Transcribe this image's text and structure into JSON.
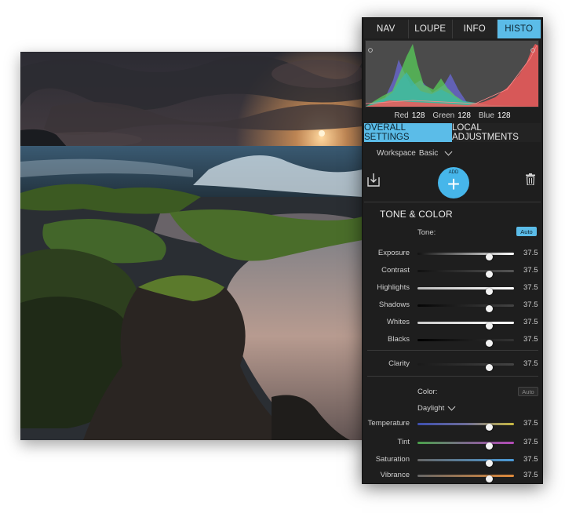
{
  "panel": {
    "tabs": [
      {
        "label": "NAV",
        "active": false
      },
      {
        "label": "LOUPE",
        "active": false
      },
      {
        "label": "INFO",
        "active": false
      },
      {
        "label": "HISTO",
        "active": true
      }
    ],
    "rgb": {
      "red_label": "Red",
      "red_value": "128",
      "green_label": "Green",
      "green_value": "128",
      "blue_label": "Blue",
      "blue_value": "128"
    },
    "settings_tabs": [
      {
        "label": "OVERALL SETTINGS",
        "active": true
      },
      {
        "label": "LOCAL ADJUSTMENTS",
        "active": false
      }
    ],
    "workspace": {
      "label": "Workspace",
      "value": "Basic"
    },
    "add_label": "ADD",
    "section_title": "TONE & COLOR",
    "tone": {
      "label": "Tone:",
      "auto_label": "Auto",
      "sliders": [
        {
          "label": "Exposure",
          "value": "37.5",
          "level": 0.74
        },
        {
          "label": "Contrast",
          "value": "37.5",
          "level": 0.74
        },
        {
          "label": "Highlights",
          "value": "37.5",
          "level": 0.74
        },
        {
          "label": "Shadows",
          "value": "37.5",
          "level": 0.74
        },
        {
          "label": "Whites",
          "value": "37.5",
          "level": 0.74
        },
        {
          "label": "Blacks",
          "value": "37.5",
          "level": 0.74
        }
      ],
      "clarity": {
        "label": "Clarity",
        "value": "37.5",
        "level": 0.74
      }
    },
    "color": {
      "label": "Color:",
      "auto_label": "Auto",
      "preset": "Daylight",
      "sliders": [
        {
          "label": "Temperature",
          "value": "37.5",
          "level": 0.74
        },
        {
          "label": "Tint",
          "value": "37.5",
          "level": 0.74
        },
        {
          "label": "Saturation",
          "value": "37.5",
          "level": 0.74
        },
        {
          "label": "Vibrance",
          "value": "37.5",
          "level": 0.74
        }
      ]
    },
    "colors": {
      "accent": "#5bbce8",
      "panel_bg": "#1e1e1e",
      "hist_red": "#f05a5a",
      "hist_green": "#58d65a",
      "hist_blue": "#6a68d8"
    }
  }
}
